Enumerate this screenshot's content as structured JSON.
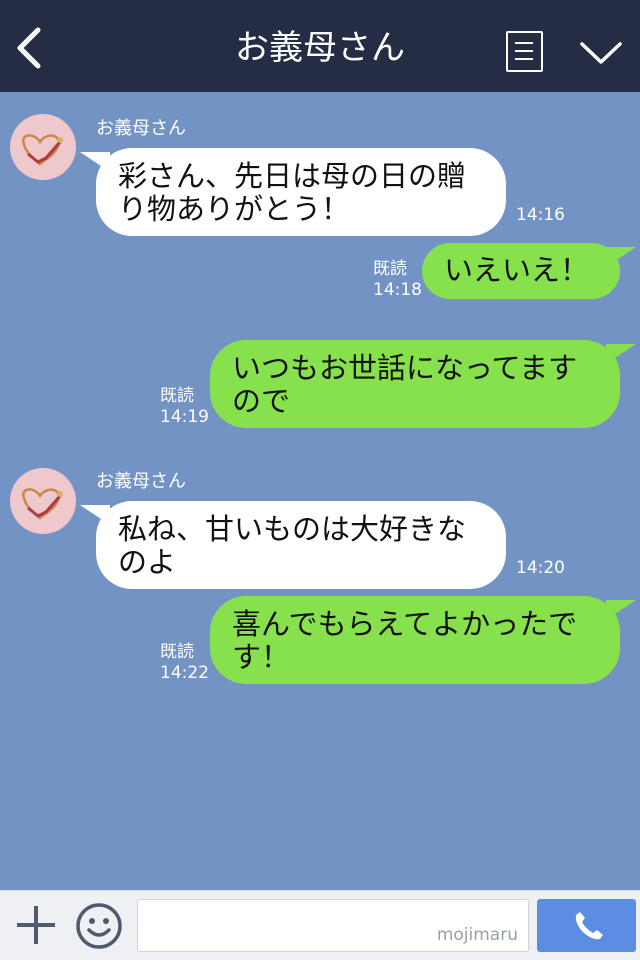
{
  "header": {
    "title": "お義母さん",
    "back_icon": "chevron-left-icon",
    "menu_icon": "list-icon",
    "more_icon": "chevron-down-icon"
  },
  "messages": [
    {
      "direction": "in",
      "sender": "お義母さん",
      "lines": [
        "彩さん、先日は母の日の贈",
        "り物ありがとう！"
      ],
      "time": "14:16"
    },
    {
      "direction": "out",
      "lines": [
        "いえいえ！"
      ],
      "read": "既読",
      "time": "14:18"
    },
    {
      "direction": "out",
      "lines": [
        "いつもお世話になってます",
        "ので"
      ],
      "read": "既読",
      "time": "14:19"
    },
    {
      "direction": "in",
      "sender": "お義母さん",
      "lines": [
        "私ね、甘いものは大好きな",
        "のよ"
      ],
      "time": "14:20"
    },
    {
      "direction": "out",
      "lines": [
        "喜んでもらえてよかったで",
        "す！"
      ],
      "read": "既読",
      "time": "14:22"
    }
  ],
  "footer": {
    "plus_icon": "plus-icon",
    "emoji_icon": "smiley-icon",
    "input_value": "",
    "watermark": "mojimaru",
    "call_icon": "phone-icon"
  },
  "colors": {
    "header_bg": "#252d44",
    "chat_bg": "#7393c4",
    "bubble_in": "#ffffff",
    "bubble_out": "#86e14c",
    "call_button": "#5b8ee3"
  }
}
